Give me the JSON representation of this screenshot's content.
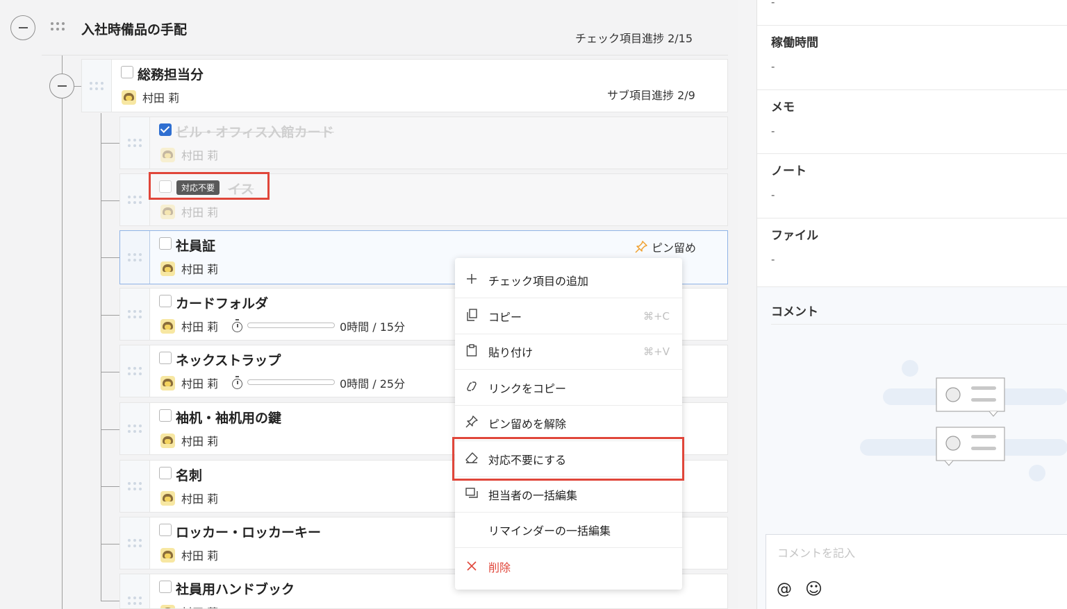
{
  "checklist": {
    "title": "入社時備品の手配",
    "progress": "チェック項目進捗 2/15",
    "group": {
      "title": "総務担当分",
      "assignee": "村田 莉",
      "sub_progress": "サブ項目進捗 2/9"
    },
    "items": [
      {
        "title": "ビル・オフィス入館カード",
        "assignee": "村田 莉",
        "state": "checked"
      },
      {
        "title": "イス",
        "assignee": "村田 莉",
        "state": "not-required",
        "tag": "対応不要"
      },
      {
        "title": "社員証",
        "assignee": "村田 莉",
        "state": "selected",
        "pin_label": "ピン留め"
      },
      {
        "title": "カードフォルダ",
        "assignee": "村田 莉",
        "time": "0時間 / 15分"
      },
      {
        "title": "ネックストラップ",
        "assignee": "村田 莉",
        "time": "0時間 / 25分"
      },
      {
        "title": "袖机・袖机用の鍵",
        "assignee": "村田 莉"
      },
      {
        "title": "名刺",
        "assignee": "村田 莉"
      },
      {
        "title": "ロッカー・ロッカーキー",
        "assignee": "村田 莉"
      },
      {
        "title": "社員用ハンドブック",
        "assignee": "村田 莉"
      }
    ]
  },
  "context_menu": {
    "items": [
      {
        "icon": "plus-icon",
        "label": "チェック項目の追加",
        "shortcut": ""
      },
      {
        "icon": "copy-icon",
        "label": "コピー",
        "shortcut": "⌘+C"
      },
      {
        "icon": "clipboard-icon",
        "label": "貼り付け",
        "shortcut": "⌘+V"
      },
      {
        "icon": "link-icon",
        "label": "リンクをコピー",
        "shortcut": ""
      },
      {
        "icon": "pin-icon",
        "label": "ピン留めを解除",
        "shortcut": ""
      },
      {
        "icon": "eraser-icon",
        "label": "対応不要にする",
        "shortcut": ""
      },
      {
        "icon": "assign-icon",
        "label": "担当者の一括編集",
        "shortcut": ""
      },
      {
        "icon": "",
        "label": "リマインダーの一括編集",
        "shortcut": ""
      },
      {
        "icon": "close-icon",
        "label": "削除",
        "shortcut": ""
      }
    ]
  },
  "side_panel": {
    "top_value": "-",
    "sections": [
      {
        "title": "稼働時間",
        "value": "-"
      },
      {
        "title": "メモ",
        "value": "-"
      },
      {
        "title": "ノート",
        "value": "-"
      },
      {
        "title": "ファイル",
        "value": "-"
      }
    ],
    "comment_title": "コメント",
    "comment_placeholder": "コメントを記入",
    "mention_symbol": "@",
    "emoji_symbol": "☺"
  },
  "colors": {
    "accent": "#2f6fd1",
    "highlight_red": "#e0463a",
    "danger": "#e0463a",
    "pin": "#f0a030"
  }
}
